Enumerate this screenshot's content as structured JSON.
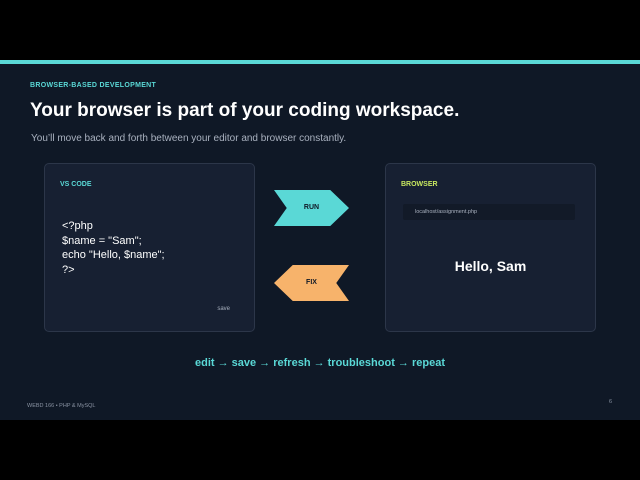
{
  "slide": {
    "eyebrow": "BROWSER-BASED DEVELOPMENT",
    "title": "Your browser is part of your coding workspace.",
    "subtitle": "You’ll move back and forth between your editor and browser constantly."
  },
  "editor_panel": {
    "label": "VS CODE",
    "code_lines": [
      "<?php",
      "$name = \"Sam\";",
      "echo \"Hello, $name\";",
      "?>"
    ],
    "save_note": "save"
  },
  "browser_panel": {
    "label": "BROWSER",
    "url": "localhost/assignment.php",
    "output": "Hello, Sam"
  },
  "arrows": {
    "run_label": "RUN",
    "fix_label": "FIX"
  },
  "workflow": "edit → save → refresh → troubleshoot → repeat",
  "footer": {
    "course": "WEBD 166 • PHP & MySQL",
    "page_number": "6"
  },
  "colors": {
    "background": "#0f1826",
    "accent_teal": "#5ad8d6",
    "accent_lime": "#c8e860",
    "accent_orange": "#f7b36b"
  }
}
